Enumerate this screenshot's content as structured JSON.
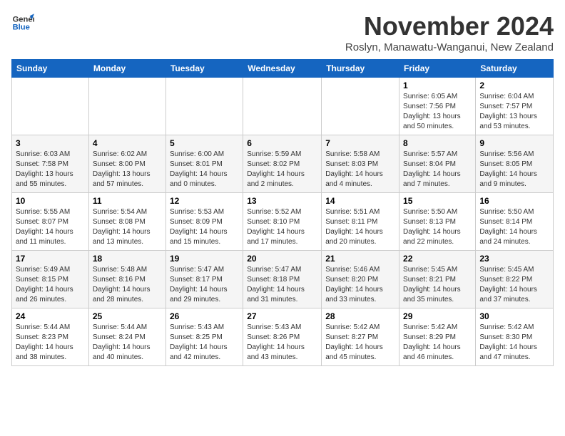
{
  "logo": {
    "line1": "General",
    "line2": "Blue"
  },
  "title": "November 2024",
  "subtitle": "Roslyn, Manawatu-Wanganui, New Zealand",
  "days_of_week": [
    "Sunday",
    "Monday",
    "Tuesday",
    "Wednesday",
    "Thursday",
    "Friday",
    "Saturday"
  ],
  "weeks": [
    [
      {
        "day": "",
        "content": ""
      },
      {
        "day": "",
        "content": ""
      },
      {
        "day": "",
        "content": ""
      },
      {
        "day": "",
        "content": ""
      },
      {
        "day": "",
        "content": ""
      },
      {
        "day": "1",
        "content": "Sunrise: 6:05 AM\nSunset: 7:56 PM\nDaylight: 13 hours\nand 50 minutes."
      },
      {
        "day": "2",
        "content": "Sunrise: 6:04 AM\nSunset: 7:57 PM\nDaylight: 13 hours\nand 53 minutes."
      }
    ],
    [
      {
        "day": "3",
        "content": "Sunrise: 6:03 AM\nSunset: 7:58 PM\nDaylight: 13 hours\nand 55 minutes."
      },
      {
        "day": "4",
        "content": "Sunrise: 6:02 AM\nSunset: 8:00 PM\nDaylight: 13 hours\nand 57 minutes."
      },
      {
        "day": "5",
        "content": "Sunrise: 6:00 AM\nSunset: 8:01 PM\nDaylight: 14 hours\nand 0 minutes."
      },
      {
        "day": "6",
        "content": "Sunrise: 5:59 AM\nSunset: 8:02 PM\nDaylight: 14 hours\nand 2 minutes."
      },
      {
        "day": "7",
        "content": "Sunrise: 5:58 AM\nSunset: 8:03 PM\nDaylight: 14 hours\nand 4 minutes."
      },
      {
        "day": "8",
        "content": "Sunrise: 5:57 AM\nSunset: 8:04 PM\nDaylight: 14 hours\nand 7 minutes."
      },
      {
        "day": "9",
        "content": "Sunrise: 5:56 AM\nSunset: 8:05 PM\nDaylight: 14 hours\nand 9 minutes."
      }
    ],
    [
      {
        "day": "10",
        "content": "Sunrise: 5:55 AM\nSunset: 8:07 PM\nDaylight: 14 hours\nand 11 minutes."
      },
      {
        "day": "11",
        "content": "Sunrise: 5:54 AM\nSunset: 8:08 PM\nDaylight: 14 hours\nand 13 minutes."
      },
      {
        "day": "12",
        "content": "Sunrise: 5:53 AM\nSunset: 8:09 PM\nDaylight: 14 hours\nand 15 minutes."
      },
      {
        "day": "13",
        "content": "Sunrise: 5:52 AM\nSunset: 8:10 PM\nDaylight: 14 hours\nand 17 minutes."
      },
      {
        "day": "14",
        "content": "Sunrise: 5:51 AM\nSunset: 8:11 PM\nDaylight: 14 hours\nand 20 minutes."
      },
      {
        "day": "15",
        "content": "Sunrise: 5:50 AM\nSunset: 8:13 PM\nDaylight: 14 hours\nand 22 minutes."
      },
      {
        "day": "16",
        "content": "Sunrise: 5:50 AM\nSunset: 8:14 PM\nDaylight: 14 hours\nand 24 minutes."
      }
    ],
    [
      {
        "day": "17",
        "content": "Sunrise: 5:49 AM\nSunset: 8:15 PM\nDaylight: 14 hours\nand 26 minutes."
      },
      {
        "day": "18",
        "content": "Sunrise: 5:48 AM\nSunset: 8:16 PM\nDaylight: 14 hours\nand 28 minutes."
      },
      {
        "day": "19",
        "content": "Sunrise: 5:47 AM\nSunset: 8:17 PM\nDaylight: 14 hours\nand 29 minutes."
      },
      {
        "day": "20",
        "content": "Sunrise: 5:47 AM\nSunset: 8:18 PM\nDaylight: 14 hours\nand 31 minutes."
      },
      {
        "day": "21",
        "content": "Sunrise: 5:46 AM\nSunset: 8:20 PM\nDaylight: 14 hours\nand 33 minutes."
      },
      {
        "day": "22",
        "content": "Sunrise: 5:45 AM\nSunset: 8:21 PM\nDaylight: 14 hours\nand 35 minutes."
      },
      {
        "day": "23",
        "content": "Sunrise: 5:45 AM\nSunset: 8:22 PM\nDaylight: 14 hours\nand 37 minutes."
      }
    ],
    [
      {
        "day": "24",
        "content": "Sunrise: 5:44 AM\nSunset: 8:23 PM\nDaylight: 14 hours\nand 38 minutes."
      },
      {
        "day": "25",
        "content": "Sunrise: 5:44 AM\nSunset: 8:24 PM\nDaylight: 14 hours\nand 40 minutes."
      },
      {
        "day": "26",
        "content": "Sunrise: 5:43 AM\nSunset: 8:25 PM\nDaylight: 14 hours\nand 42 minutes."
      },
      {
        "day": "27",
        "content": "Sunrise: 5:43 AM\nSunset: 8:26 PM\nDaylight: 14 hours\nand 43 minutes."
      },
      {
        "day": "28",
        "content": "Sunrise: 5:42 AM\nSunset: 8:27 PM\nDaylight: 14 hours\nand 45 minutes."
      },
      {
        "day": "29",
        "content": "Sunrise: 5:42 AM\nSunset: 8:29 PM\nDaylight: 14 hours\nand 46 minutes."
      },
      {
        "day": "30",
        "content": "Sunrise: 5:42 AM\nSunset: 8:30 PM\nDaylight: 14 hours\nand 47 minutes."
      }
    ]
  ]
}
